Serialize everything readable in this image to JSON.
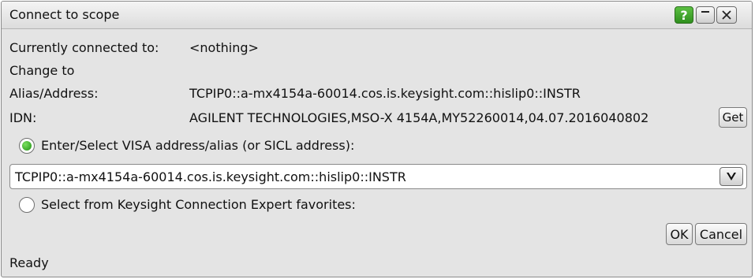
{
  "window": {
    "title": "Connect to scope"
  },
  "titlebar": {
    "help_label": "?"
  },
  "current": {
    "label": "Currently connected to:",
    "value": "<nothing>"
  },
  "change_to": "Change to",
  "alias": {
    "label": "Alias/Address:",
    "value": "TCPIP0::a-mx4154a-60014.cos.is.keysight.com::hislip0::INSTR"
  },
  "idn": {
    "label": "IDN:",
    "value": "AGILENT TECHNOLOGIES,MSO-X 4154A,MY52260014,04.07.2016040802",
    "get_label": "Get"
  },
  "options": {
    "visa": {
      "label": "Enter/Select VISA address/alias (or SICL address):",
      "selected": true
    },
    "favorites": {
      "label": "Select from Keysight Connection Expert favorites:",
      "selected": false
    }
  },
  "address_combo": {
    "value": "TCPIP0::a-mx4154a-60014.cos.is.keysight.com::hislip0::INSTR"
  },
  "buttons": {
    "ok": "OK",
    "cancel": "Cancel"
  },
  "status": "Ready"
}
